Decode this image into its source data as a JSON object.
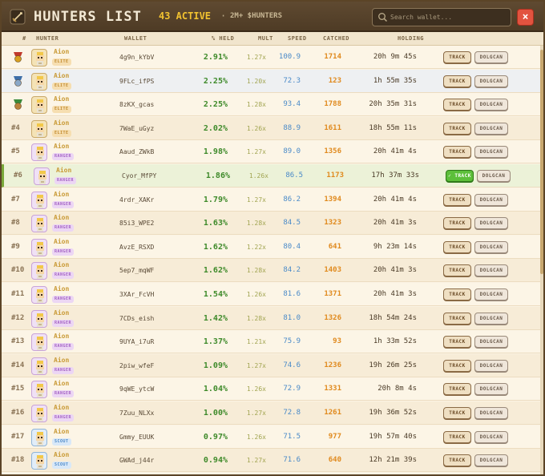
{
  "header": {
    "title": "HUNTERS LIST",
    "active": "43 ACTIVE",
    "separator": "·",
    "subtitle": "2M+ $HUNTERS",
    "search_placeholder": "Search wallet...",
    "close_label": "×"
  },
  "columns": {
    "rank": "#",
    "hunter": "HUNTER",
    "wallet": "WALLET",
    "held": "% HELD",
    "mult": "MULT",
    "speed": "SPEED",
    "catched": "CATCHED",
    "holding": "HOLDING"
  },
  "buttons": {
    "track": "TRACK",
    "dolgcan": "DOLGCAN"
  },
  "colors": {
    "elite": "#c99a36",
    "ranger": "#a463c4",
    "scout": "#4a88c8",
    "accent": "#f2c230",
    "close": "#e2533f",
    "track_active": "#5cbf3a"
  },
  "rows": [
    {
      "rank": "",
      "medal": "gold",
      "name": "Aion",
      "tier": "ELITE",
      "wallet": "4g9n_kYbV",
      "held": "2.91%",
      "mult": "1.27x",
      "speed": "100.9",
      "catched": "1714",
      "holding": "20h 9m 45s",
      "tracking": false
    },
    {
      "rank": "",
      "medal": "silver",
      "name": "Aion",
      "tier": "ELITE",
      "wallet": "9FLc_ifPS",
      "held": "2.25%",
      "mult": "1.20x",
      "speed": "72.3",
      "catched": "123",
      "holding": "1h 55m 35s",
      "tracking": false
    },
    {
      "rank": "",
      "medal": "bronze",
      "name": "Aion",
      "tier": "ELITE",
      "wallet": "8zKX_gcas",
      "held": "2.25%",
      "mult": "1.28x",
      "speed": "93.4",
      "catched": "1788",
      "holding": "20h 35m 31s",
      "tracking": false
    },
    {
      "rank": "#4",
      "medal": "",
      "name": "Aion",
      "tier": "ELITE",
      "wallet": "7WaE_uGyz",
      "held": "2.02%",
      "mult": "1.26x",
      "speed": "88.9",
      "catched": "1611",
      "holding": "18h 55m 11s",
      "tracking": false
    },
    {
      "rank": "#5",
      "medal": "",
      "name": "Aion",
      "tier": "RANGER",
      "wallet": "Aaud_ZWkB",
      "held": "1.98%",
      "mult": "1.27x",
      "speed": "89.0",
      "catched": "1356",
      "holding": "20h 41m 4s",
      "tracking": false
    },
    {
      "rank": "#6",
      "medal": "",
      "name": "Aion",
      "tier": "RANGER",
      "wallet": "Cyor_MfPY",
      "held": "1.86%",
      "mult": "1.26x",
      "speed": "86.5",
      "catched": "1173",
      "holding": "17h 37m 33s",
      "tracking": true
    },
    {
      "rank": "#7",
      "medal": "",
      "name": "Aion",
      "tier": "RANGER",
      "wallet": "4rdr_XAKr",
      "held": "1.79%",
      "mult": "1.27x",
      "speed": "86.2",
      "catched": "1394",
      "holding": "20h 41m 4s",
      "tracking": false
    },
    {
      "rank": "#8",
      "medal": "",
      "name": "Aion",
      "tier": "RANGER",
      "wallet": "85i3_WPE2",
      "held": "1.63%",
      "mult": "1.28x",
      "speed": "84.5",
      "catched": "1323",
      "holding": "20h 41m 3s",
      "tracking": false
    },
    {
      "rank": "#9",
      "medal": "",
      "name": "Aion",
      "tier": "RANGER",
      "wallet": "AvzE_RSXD",
      "held": "1.62%",
      "mult": "1.22x",
      "speed": "80.4",
      "catched": "641",
      "holding": "9h 23m 14s",
      "tracking": false
    },
    {
      "rank": "#10",
      "medal": "",
      "name": "Aion",
      "tier": "RANGER",
      "wallet": "5ep7_mqWF",
      "held": "1.62%",
      "mult": "1.28x",
      "speed": "84.2",
      "catched": "1403",
      "holding": "20h 41m 3s",
      "tracking": false
    },
    {
      "rank": "#11",
      "medal": "",
      "name": "Aion",
      "tier": "RANGER",
      "wallet": "3XAr_FcVH",
      "held": "1.54%",
      "mult": "1.26x",
      "speed": "81.6",
      "catched": "1371",
      "holding": "20h 41m 3s",
      "tracking": false
    },
    {
      "rank": "#12",
      "medal": "",
      "name": "Aion",
      "tier": "RANGER",
      "wallet": "7CDs_eish",
      "held": "1.42%",
      "mult": "1.28x",
      "speed": "81.0",
      "catched": "1326",
      "holding": "18h 54m 24s",
      "tracking": false
    },
    {
      "rank": "#13",
      "medal": "",
      "name": "Aion",
      "tier": "RANGER",
      "wallet": "9UYA_i7uR",
      "held": "1.37%",
      "mult": "1.21x",
      "speed": "75.9",
      "catched": "93",
      "holding": "1h 33m 52s",
      "tracking": false
    },
    {
      "rank": "#14",
      "medal": "",
      "name": "Aion",
      "tier": "RANGER",
      "wallet": "2piw_wfeF",
      "held": "1.09%",
      "mult": "1.27x",
      "speed": "74.6",
      "catched": "1236",
      "holding": "19h 26m 25s",
      "tracking": false
    },
    {
      "rank": "#15",
      "medal": "",
      "name": "Aion",
      "tier": "RANGER",
      "wallet": "9qWE_ytcW",
      "held": "1.04%",
      "mult": "1.26x",
      "speed": "72.9",
      "catched": "1331",
      "holding": "20h 8m 4s",
      "tracking": false
    },
    {
      "rank": "#16",
      "medal": "",
      "name": "Aion",
      "tier": "RANGER",
      "wallet": "7Zuu_NLXx",
      "held": "1.00%",
      "mult": "1.27x",
      "speed": "72.8",
      "catched": "1261",
      "holding": "19h 36m 52s",
      "tracking": false
    },
    {
      "rank": "#17",
      "medal": "",
      "name": "Aion",
      "tier": "SCOUT",
      "wallet": "Gmmy_EUUK",
      "held": "0.97%",
      "mult": "1.26x",
      "speed": "71.5",
      "catched": "977",
      "holding": "19h 57m 40s",
      "tracking": false
    },
    {
      "rank": "#18",
      "medal": "",
      "name": "Aion",
      "tier": "SCOUT",
      "wallet": "GWAd_j44r",
      "held": "0.94%",
      "mult": "1.27x",
      "speed": "71.6",
      "catched": "640",
      "holding": "12h 21m 39s",
      "tracking": false
    }
  ]
}
